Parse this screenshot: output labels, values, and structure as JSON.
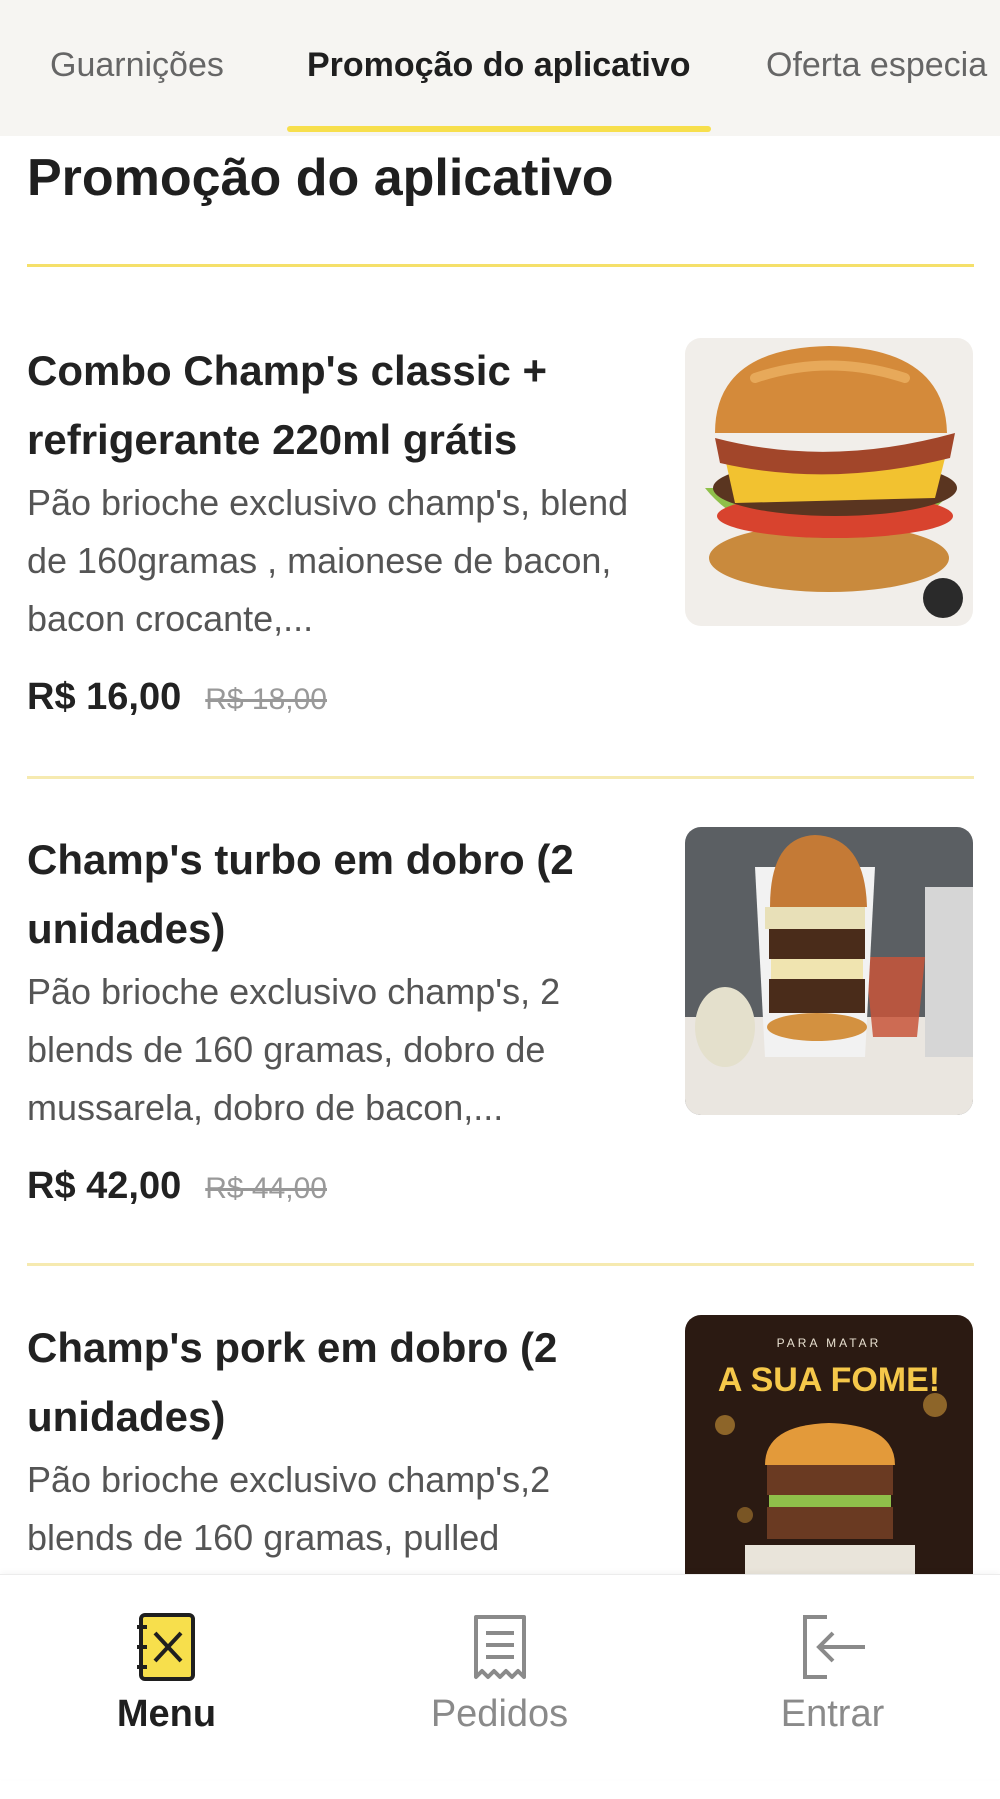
{
  "tabs": [
    {
      "label": "Guarnições"
    },
    {
      "label": "Promoção do aplicativo"
    },
    {
      "label": "Oferta especia"
    }
  ],
  "section": {
    "title": "Promoção do aplicativo"
  },
  "items": [
    {
      "name": "Combo Champ's classic + refrigerante 220ml grátis",
      "description": "Pão brioche exclusivo champ's, blend de 160gramas , maionese de bacon, bacon crocante,...",
      "price": "R$ 16,00",
      "old_price": "R$ 18,00"
    },
    {
      "name": "Champ's turbo em dobro (2 unidades)",
      "description": "Pão brioche exclusivo champ's, 2 blends de 160 gramas, dobro de mussarela, dobro de bacon,...",
      "price": "R$ 42,00",
      "old_price": "R$ 44,00"
    },
    {
      "name": "Champ's pork em dobro (2 unidades)",
      "description": "Pão brioche exclusivo champ's,2 blends de 160 gramas, pulled",
      "image_text": {
        "top": "PARA MATAR",
        "main": "A SUA FOME!"
      }
    }
  ],
  "nav": [
    {
      "label": "Menu",
      "icon": "menu-book-icon"
    },
    {
      "label": "Pedidos",
      "icon": "receipt-icon"
    },
    {
      "label": "Entrar",
      "icon": "login-icon"
    }
  ],
  "colors": {
    "accent": "#f7df4c",
    "divider": "#f5e06a",
    "tab_bar": "#f6f5f2"
  }
}
